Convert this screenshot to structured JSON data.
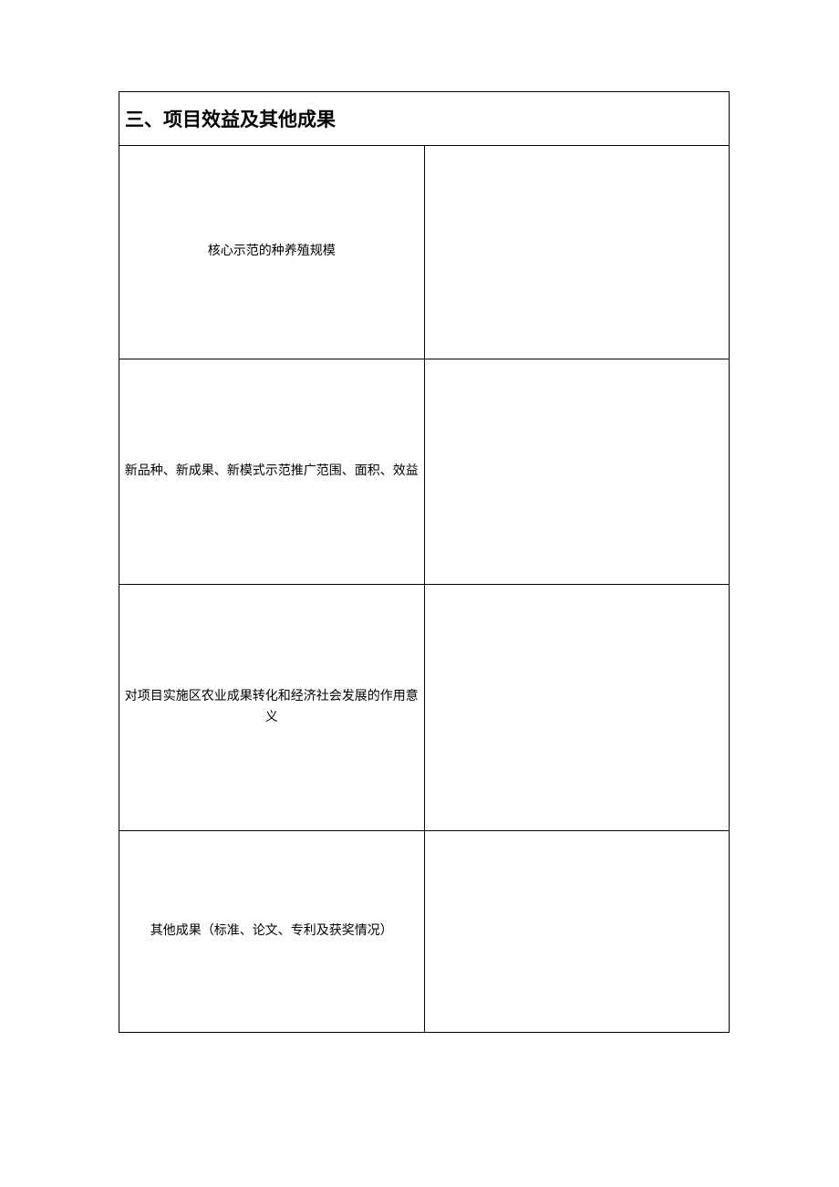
{
  "section": {
    "title": "三、项目效益及其他成果"
  },
  "rows": [
    {
      "label": "核心示范的种养殖规模",
      "content": ""
    },
    {
      "label": "新品种、新成果、新模式示范推广范围、面积、效益",
      "content": ""
    },
    {
      "label": "对项目实施区农业成果转化和经济社会发展的作用意义",
      "content": ""
    },
    {
      "label": "其他成果（标准、论文、专利及获奖情况）",
      "content": ""
    }
  ]
}
